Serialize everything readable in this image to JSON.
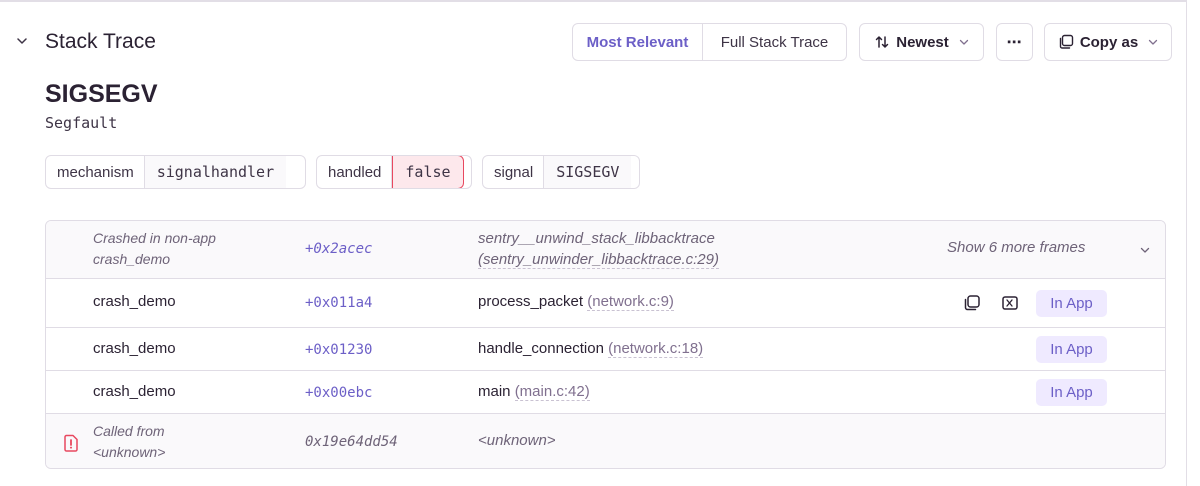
{
  "section": {
    "title": "Stack Trace",
    "collapse_icon": "chevron-down-icon"
  },
  "toolbar": {
    "view_options": [
      "Most Relevant",
      "Full Stack Trace"
    ],
    "active_view": "Most Relevant",
    "sort_label": "Newest",
    "sort_icon": "sort-arrows-icon",
    "more_label": "⋯",
    "copy_label": "Copy as",
    "copy_icon": "copy-icon",
    "dropdown_icon": "chevron-down-icon"
  },
  "exception": {
    "type": "SIGSEGV",
    "value": "Segfault"
  },
  "tags": [
    {
      "key": "mechanism",
      "value": "signalhandler"
    },
    {
      "key": "handled",
      "value": "false",
      "status": "danger"
    },
    {
      "key": "signal",
      "value": "SIGSEGV"
    }
  ],
  "frames": {
    "collapsed_row": {
      "label": "Crashed in non-app",
      "package": "crash_demo",
      "address": "+0x2acec",
      "function": "sentry__unwind_stack_libbacktrace",
      "location": "(sentry_unwinder_libbacktrace.c:29)",
      "show_more": "Show 6 more frames"
    },
    "rows": [
      {
        "package": "crash_demo",
        "address": "+0x011a4",
        "function": "process_packet",
        "location": "(network.c:9)",
        "badge": "In App"
      },
      {
        "package": "crash_demo",
        "address": "+0x01230",
        "function": "handle_connection",
        "location": "(network.c:18)",
        "badge": "In App"
      },
      {
        "package": "crash_demo",
        "address": "+0x00ebc",
        "function": "main",
        "location": "(main.c:42)",
        "badge": "In App"
      }
    ],
    "called_from": {
      "label": "Called from",
      "package": "<unknown>",
      "address": "0x19e64dd54",
      "function": "<unknown>"
    }
  },
  "colors": {
    "accent": "#6c5fc7",
    "accent_bg": "#efeaff",
    "danger": "#e8485f",
    "danger_bg": "#fde8ec",
    "border": "#e0dce5",
    "muted_text": "#6e6378"
  }
}
